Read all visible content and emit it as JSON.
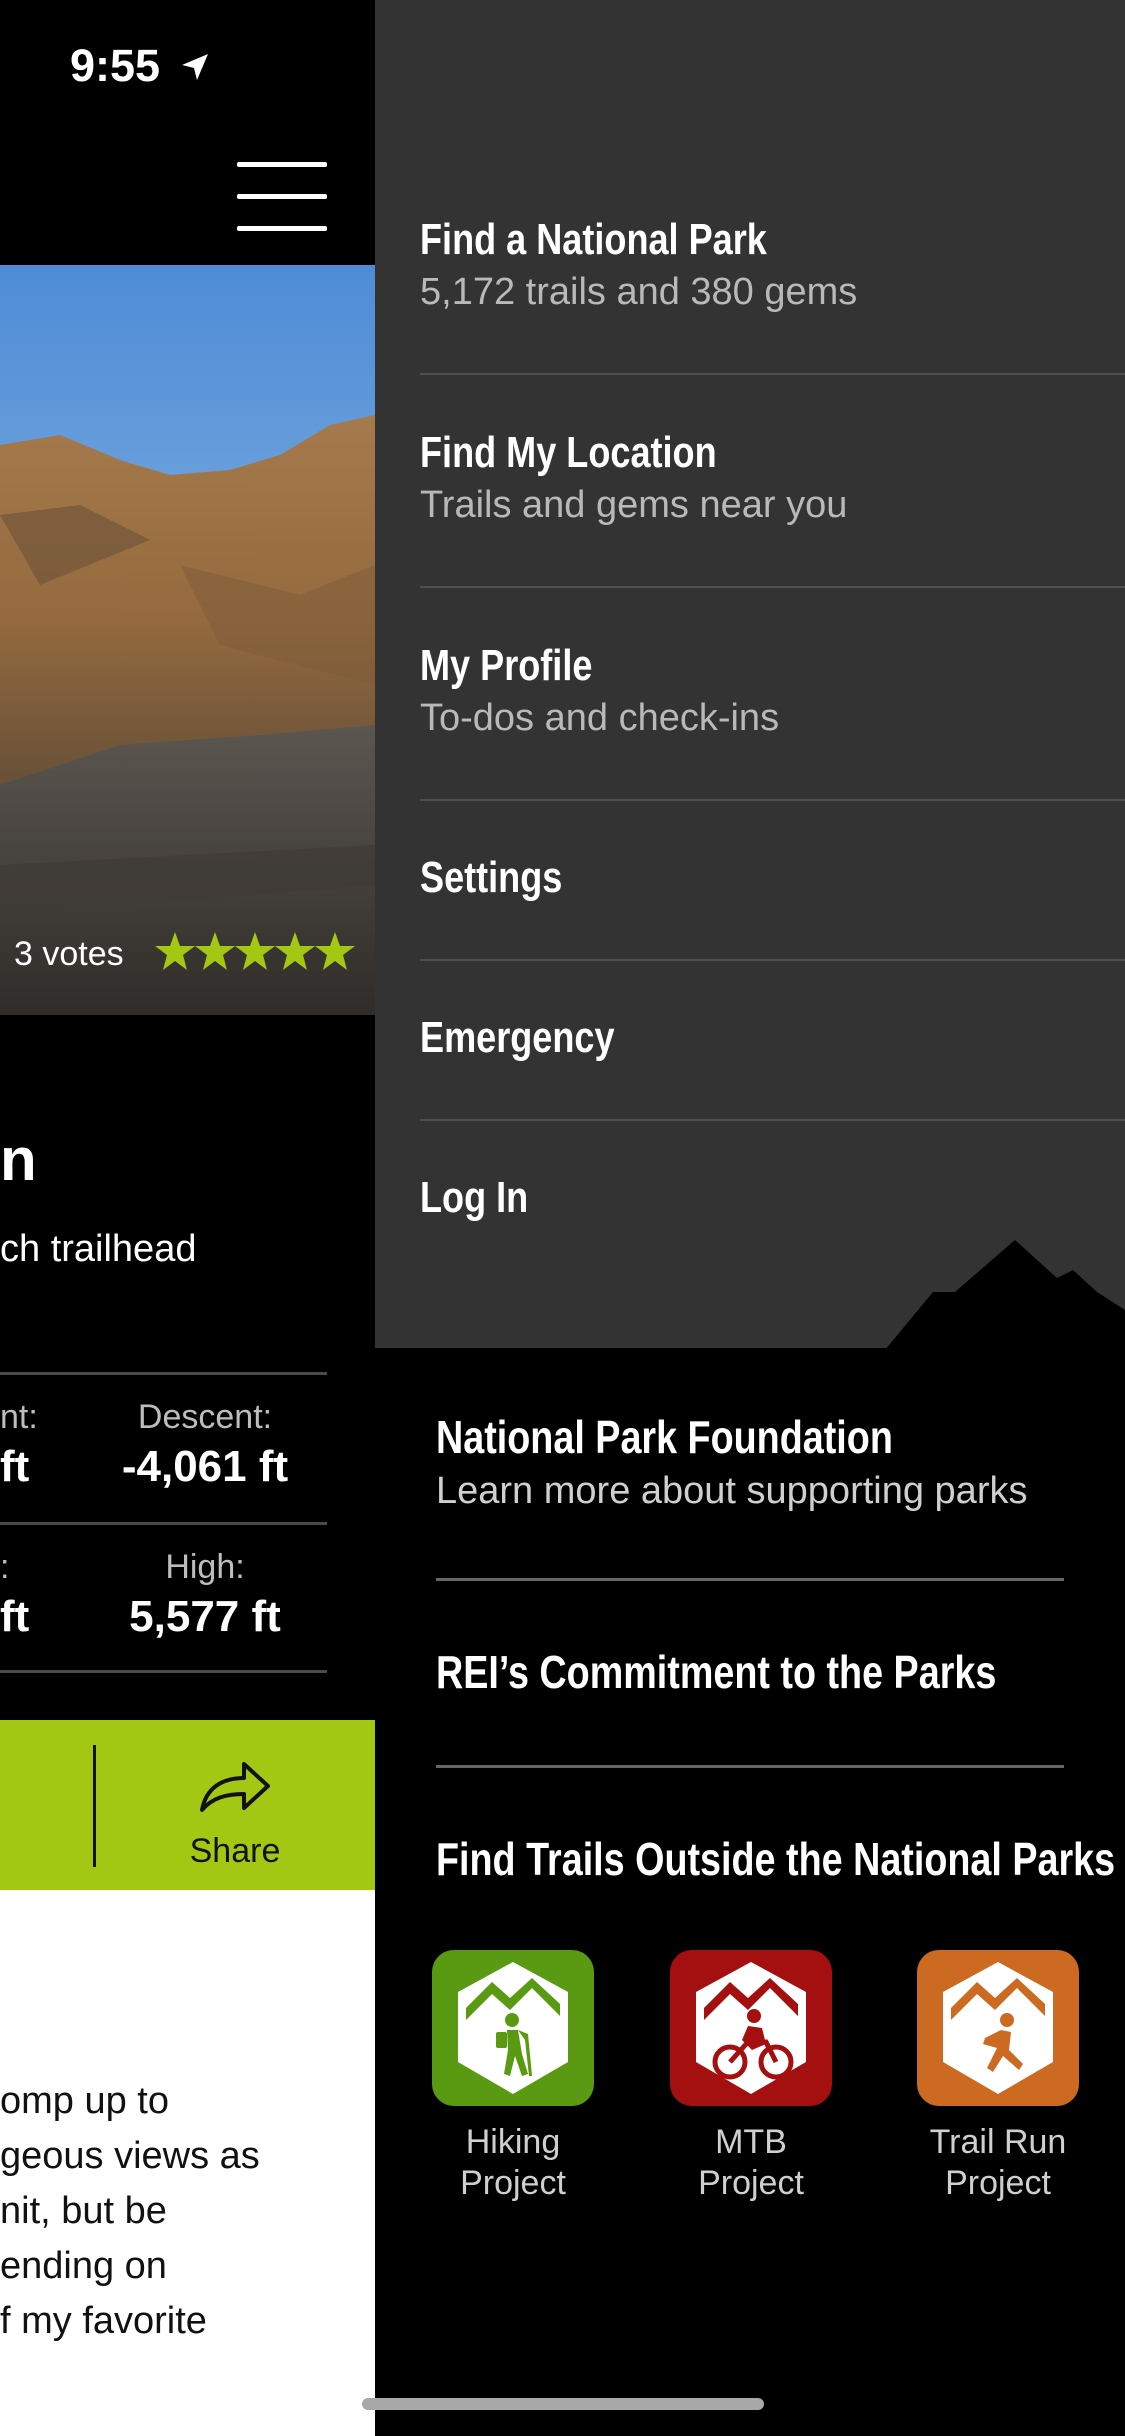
{
  "status_bar": {
    "time": "9:55"
  },
  "trail": {
    "votes": "3 votes",
    "rating": 5,
    "title_fragment": "n",
    "subtitle_fragment": "ch trailhead",
    "stats": {
      "ascent_label": "nt:",
      "ascent_value": "ft",
      "descent_label": "Descent:",
      "descent_value": "-4,061 ft",
      "low_label": ":",
      "low_value": "ft",
      "high_label": "High:",
      "high_value": "5,577 ft"
    },
    "share_label": "Share",
    "description_lines": [
      "omp up to",
      "geous views as",
      "nit, but be",
      "ending on",
      "f my favorite"
    ]
  },
  "menu": {
    "items": [
      {
        "title": "Find a National Park",
        "subtitle": "5,172 trails and 380 gems"
      },
      {
        "title": "Find My Location",
        "subtitle": "Trails and gems near you"
      },
      {
        "title": "My Profile",
        "subtitle": "To-dos and check-ins"
      },
      {
        "title": "Settings"
      },
      {
        "title": "Emergency"
      },
      {
        "title": "Log In"
      }
    ]
  },
  "links": {
    "npf_title": "National Park Foundation",
    "npf_subtitle": "Learn more about supporting parks",
    "rei_title": "REI’s Commitment to the Parks",
    "outside_title": "Find Trails Outside the National Parks"
  },
  "apps": [
    {
      "line1": "Hiking",
      "line2": "Project",
      "color": "#5a9a12",
      "icon": "hiker-icon"
    },
    {
      "line1": "MTB",
      "line2": "Project",
      "color": "#a3100f",
      "icon": "cyclist-icon"
    },
    {
      "line1": "Trail Run",
      "line2": "Project",
      "color": "#cc6a22",
      "icon": "runner-icon"
    }
  ],
  "colors": {
    "accent_green": "#a3c814",
    "drawer_bg": "#333333",
    "star": "#a3c814"
  }
}
